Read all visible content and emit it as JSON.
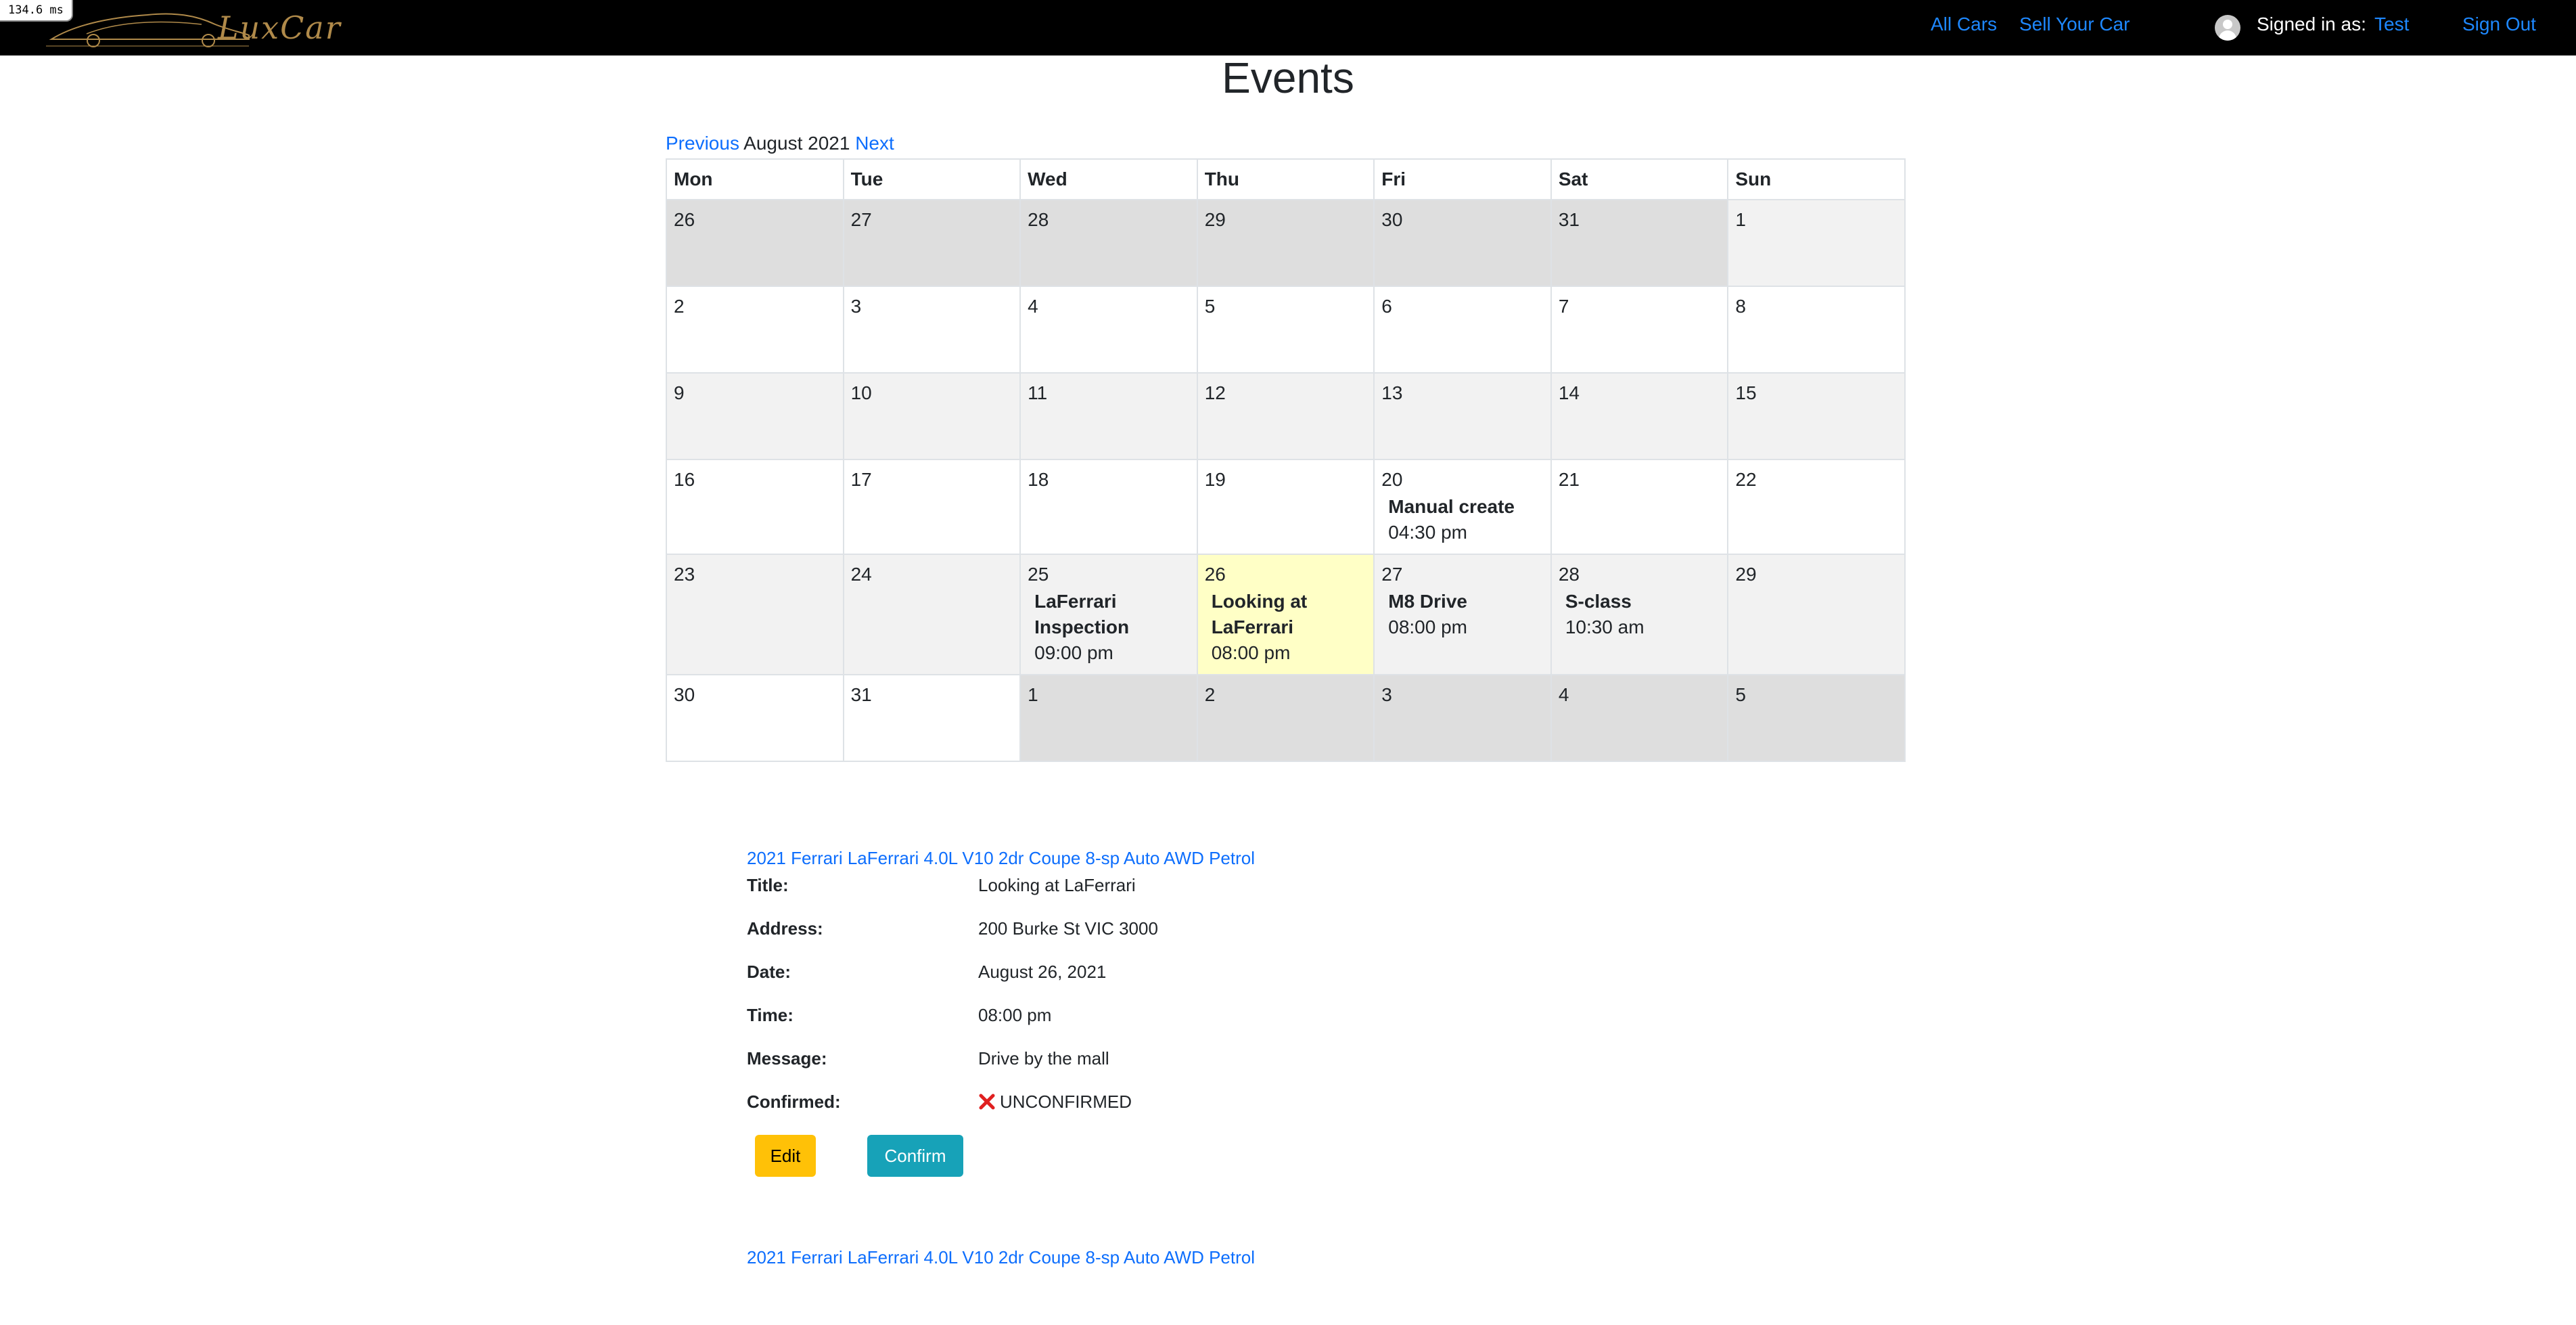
{
  "overlay": {
    "timing": "134.6 ms"
  },
  "navbar": {
    "logo_text": "LuxCar",
    "links": {
      "all_cars": "All Cars",
      "sell_car": "Sell Your Car",
      "signed_in_label": "Signed in as:",
      "user_name": "Test",
      "sign_out": "Sign Out"
    }
  },
  "page": {
    "title": "Events"
  },
  "calendar": {
    "nav": {
      "previous": "Previous",
      "current": "August 2021",
      "next": "Next"
    },
    "weekdays": [
      "Mon",
      "Tue",
      "Wed",
      "Thu",
      "Fri",
      "Sat",
      "Sun"
    ],
    "weeks": [
      [
        {
          "day": "26",
          "other": true
        },
        {
          "day": "27",
          "other": true
        },
        {
          "day": "28",
          "other": true
        },
        {
          "day": "29",
          "other": true
        },
        {
          "day": "30",
          "other": true
        },
        {
          "day": "31",
          "other": true
        },
        {
          "day": "1"
        }
      ],
      [
        {
          "day": "2"
        },
        {
          "day": "3"
        },
        {
          "day": "4"
        },
        {
          "day": "5"
        },
        {
          "day": "6"
        },
        {
          "day": "7"
        },
        {
          "day": "8"
        }
      ],
      [
        {
          "day": "9"
        },
        {
          "day": "10"
        },
        {
          "day": "11"
        },
        {
          "day": "12"
        },
        {
          "day": "13"
        },
        {
          "day": "14"
        },
        {
          "day": "15"
        }
      ],
      [
        {
          "day": "16"
        },
        {
          "day": "17"
        },
        {
          "day": "18"
        },
        {
          "day": "19"
        },
        {
          "day": "20",
          "events": [
            {
              "title": "Manual create",
              "time": "04:30 pm"
            }
          ]
        },
        {
          "day": "21"
        },
        {
          "day": "22"
        }
      ],
      [
        {
          "day": "23"
        },
        {
          "day": "24"
        },
        {
          "day": "25",
          "events": [
            {
              "title": "LaFerrari Inspection",
              "time": "09:00 pm"
            }
          ]
        },
        {
          "day": "26",
          "today": true,
          "events": [
            {
              "title": "Looking at LaFerrari",
              "time": "08:00 pm"
            }
          ]
        },
        {
          "day": "27",
          "events": [
            {
              "title": "M8 Drive",
              "time": "08:00 pm"
            }
          ]
        },
        {
          "day": "28",
          "events": [
            {
              "title": "S-class",
              "time": "10:30 am"
            }
          ]
        },
        {
          "day": "29"
        }
      ],
      [
        {
          "day": "30"
        },
        {
          "day": "31"
        },
        {
          "day": "1",
          "other": true
        },
        {
          "day": "2",
          "other": true
        },
        {
          "day": "3",
          "other": true
        },
        {
          "day": "4",
          "other": true
        },
        {
          "day": "5",
          "other": true
        }
      ]
    ]
  },
  "event_detail": {
    "car_link": "2021 Ferrari LaFerrari 4.0L V10 2dr Coupe 8-sp Auto AWD Petrol",
    "rows": [
      {
        "label": "Title:",
        "value": "Looking at LaFerrari"
      },
      {
        "label": "Address:",
        "value": "200 Burke St VIC 3000"
      },
      {
        "label": "Date:",
        "value": "August 26, 2021"
      },
      {
        "label": "Time:",
        "value": "08:00 pm"
      },
      {
        "label": "Message:",
        "value": "Drive by the mall"
      }
    ],
    "confirmed_label": "Confirmed:",
    "confirmed_value": "UNCONFIRMED",
    "confirmed_icon": "x-mark-icon",
    "edit_button": "Edit",
    "confirm_button": "Confirm"
  },
  "next_event": {
    "car_link": "2021 Ferrari LaFerrari 4.0L V10 2dr Coupe 8-sp Auto AWD Petrol"
  },
  "colors": {
    "navbar_bg": "#000000",
    "link": "#0d6efd",
    "today_highlight": "#ffffc6",
    "edit_button": "#ffc107",
    "confirm_button": "#17a2b8",
    "unconfirmed_icon": "#e02020"
  }
}
